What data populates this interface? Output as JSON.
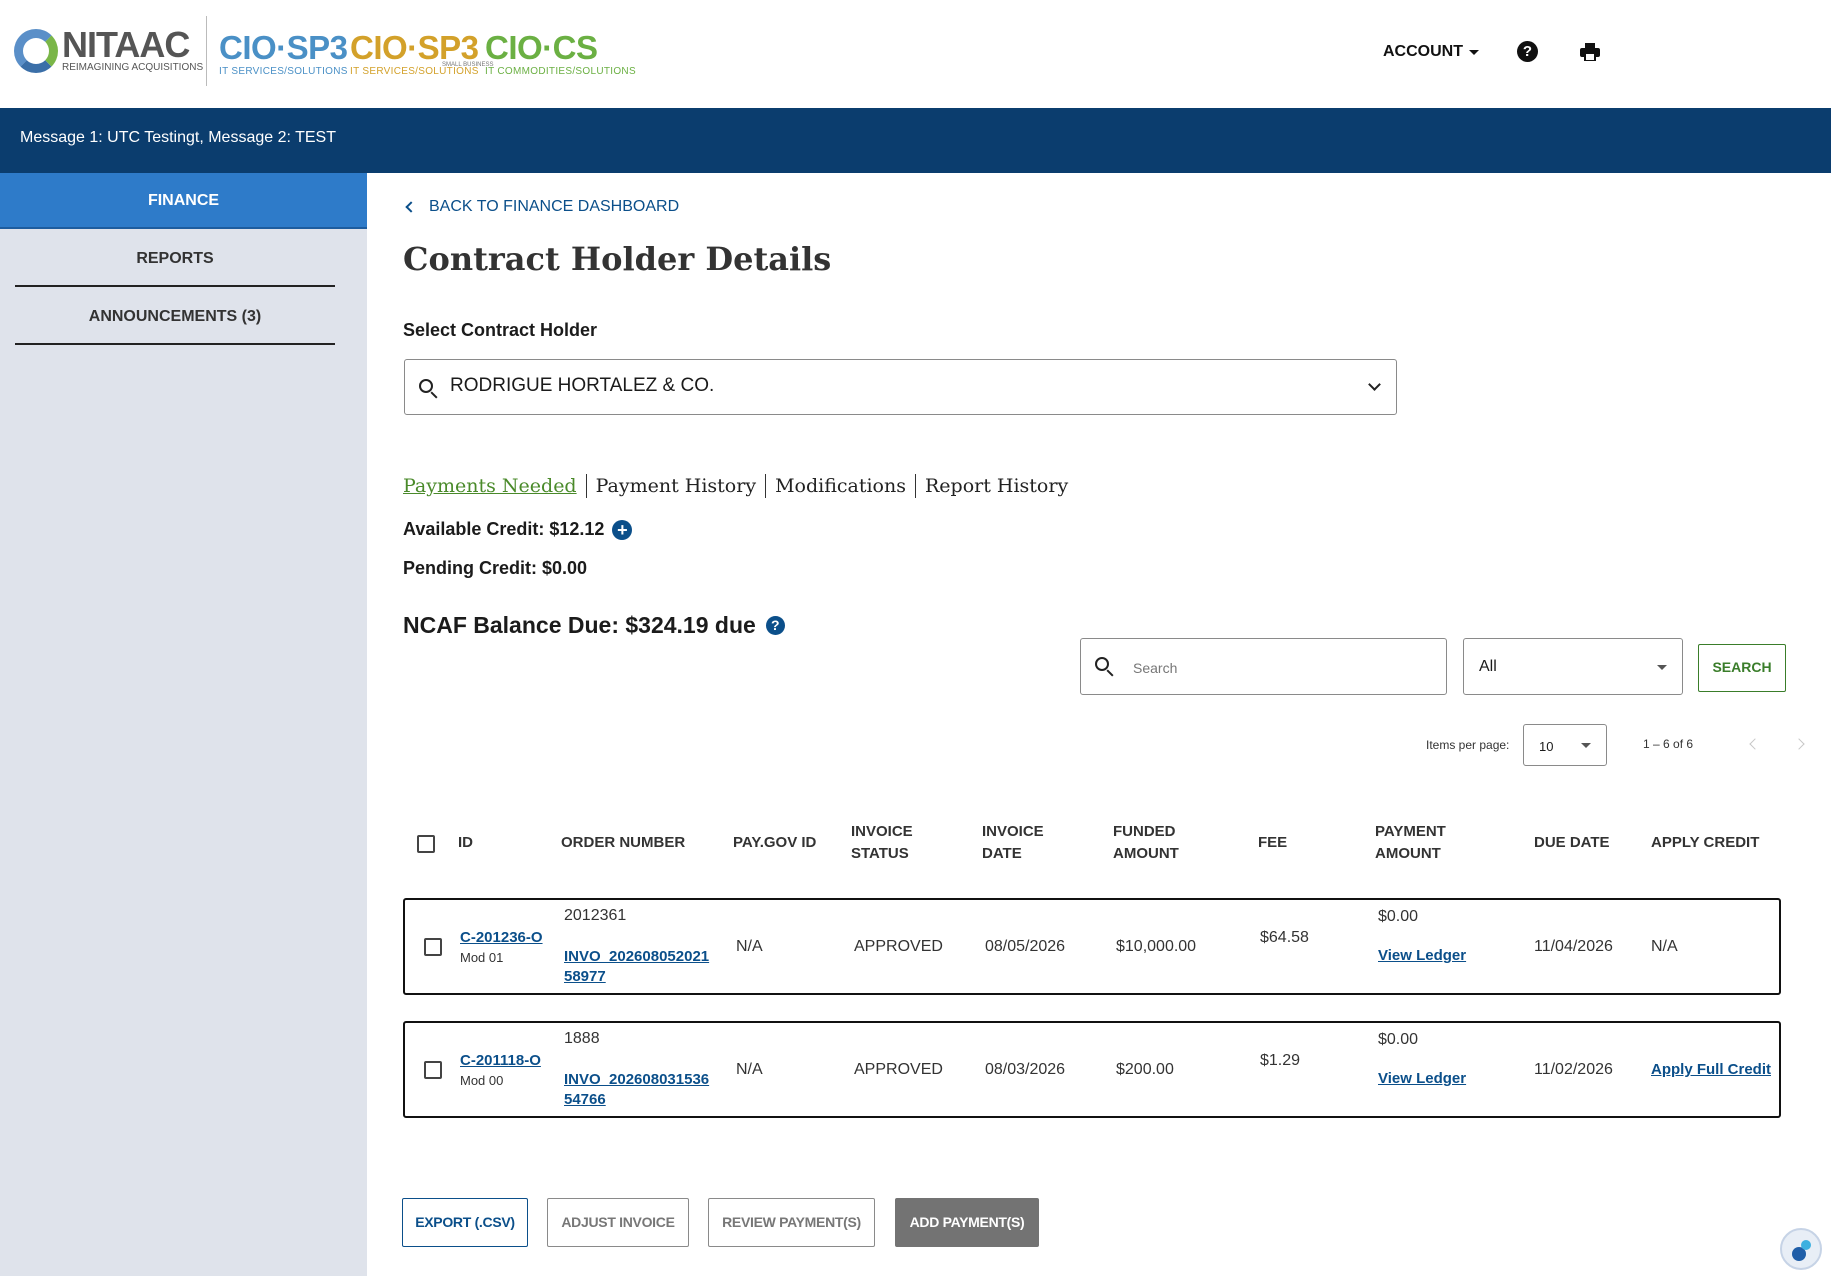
{
  "header": {
    "logo": {
      "name": "NITAAC",
      "tagline": "REIMAGINING ACQUISITIONS"
    },
    "brands": [
      {
        "name": "CIO·SP3",
        "sub": "IT SERVICES/SOLUTIONS",
        "color": "#4a90c6"
      },
      {
        "name": "CIO·SP3",
        "sub": "IT SERVICES/SOLUTIONS",
        "badge": "SMALL BUSINESS",
        "color": "#d3a12a"
      },
      {
        "name": "CIO·CS",
        "sub": "IT COMMODITIES/SOLUTIONS",
        "color": "#6bb043"
      }
    ],
    "account_label": "ACCOUNT",
    "help_icon": "question-circle-icon",
    "print_icon": "printer-icon"
  },
  "banner": {
    "message": "Message 1: UTC Testingt, Message 2: TEST"
  },
  "sidebar": {
    "items": [
      {
        "label": "FINANCE",
        "active": true
      },
      {
        "label": "REPORTS",
        "active": false
      },
      {
        "label": "ANNOUNCEMENTS (3)",
        "active": false
      }
    ]
  },
  "main": {
    "back_link": "BACK TO FINANCE DASHBOARD",
    "title": "Contract Holder Details",
    "select_label": "Select Contract Holder",
    "selected_holder": "RODRIGUE HORTALEZ & CO.",
    "tabs": [
      {
        "label": "Payments Needed",
        "active": true
      },
      {
        "label": "Payment History",
        "active": false
      },
      {
        "label": "Modifications",
        "active": false
      },
      {
        "label": "Report History",
        "active": false
      }
    ],
    "available_credit": "Available Credit: $12.12",
    "pending_credit": "Pending Credit: $0.00",
    "balance_due": "NCAF Balance Due: $324.19 due",
    "search": {
      "placeholder": "Search",
      "filter_value": "All",
      "button_label": "SEARCH"
    },
    "pagination": {
      "items_per_page_label": "Items per page:",
      "items_per_page": "10",
      "range": "1 – 6 of 6"
    }
  },
  "table": {
    "columns": [
      {
        "line1": "ID",
        "line2": ""
      },
      {
        "line1": "ORDER NUMBER",
        "line2": ""
      },
      {
        "line1": "PAY.GOV ID",
        "line2": ""
      },
      {
        "line1": "INVOICE",
        "line2": "STATUS"
      },
      {
        "line1": "INVOICE",
        "line2": "DATE"
      },
      {
        "line1": "FUNDED",
        "line2": "AMOUNT"
      },
      {
        "line1": "FEE",
        "line2": ""
      },
      {
        "line1": "PAYMENT",
        "line2": "AMOUNT"
      },
      {
        "line1": "DUE DATE",
        "line2": ""
      },
      {
        "line1": "APPLY CREDIT",
        "line2": ""
      }
    ],
    "rows": [
      {
        "id": "C-201236-O",
        "mod": "Mod 01",
        "order_number": "2012361",
        "invoice_link_1": "INVO_202608052021",
        "invoice_link_2": "58977",
        "paygov_id": "N/A",
        "status": "APPROVED",
        "invoice_date": "08/05/2026",
        "funded_amount": "$10,000.00",
        "fee": "$64.58",
        "payment_amount": "$0.00",
        "ledger_link": "View Ledger",
        "due_date": "11/04/2026",
        "apply_credit": "N/A"
      },
      {
        "id": "C-201118-O",
        "mod": "Mod 00",
        "order_number": "1888",
        "invoice_link_1": "INVO_202608031536",
        "invoice_link_2": "54766",
        "paygov_id": "N/A",
        "status": "APPROVED",
        "invoice_date": "08/03/2026",
        "funded_amount": "$200.00",
        "fee": "$1.29",
        "payment_amount": "$0.00",
        "ledger_link": "View Ledger",
        "due_date": "11/02/2026",
        "apply_credit": "Apply Full Credit"
      }
    ]
  },
  "actions": {
    "export": "EXPORT (.CSV)",
    "adjust": "ADJUST INVOICE",
    "review": "REVIEW PAYMENT(S)",
    "add": "ADD PAYMENT(S)"
  },
  "colors": {
    "banner": "#0b3d6e",
    "sidebar_active": "#2e7bc9",
    "link": "#0b4f8a",
    "accent_green": "#3a7d2a"
  }
}
